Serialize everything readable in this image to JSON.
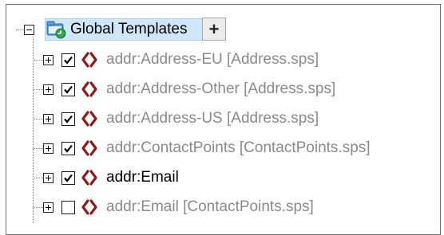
{
  "tree": {
    "root": {
      "label": "Global Templates",
      "add_button": "+"
    },
    "items": [
      {
        "label": "addr:Address-EU [Address.sps]",
        "checked": true,
        "active": false
      },
      {
        "label": "addr:Address-Other [Address.sps]",
        "checked": true,
        "active": false
      },
      {
        "label": "addr:Address-US [Address.sps]",
        "checked": true,
        "active": false
      },
      {
        "label": "addr:ContactPoints [ContactPoints.sps]",
        "checked": true,
        "active": false
      },
      {
        "label": "addr:Email",
        "checked": true,
        "active": true
      },
      {
        "label": "addr:Email [ContactPoints.sps]",
        "checked": false,
        "active": false
      }
    ]
  },
  "colors": {
    "template_icon": "#8b1a1a",
    "inactive_text": "#8a8a8a",
    "highlight": "#cfe6fb"
  }
}
